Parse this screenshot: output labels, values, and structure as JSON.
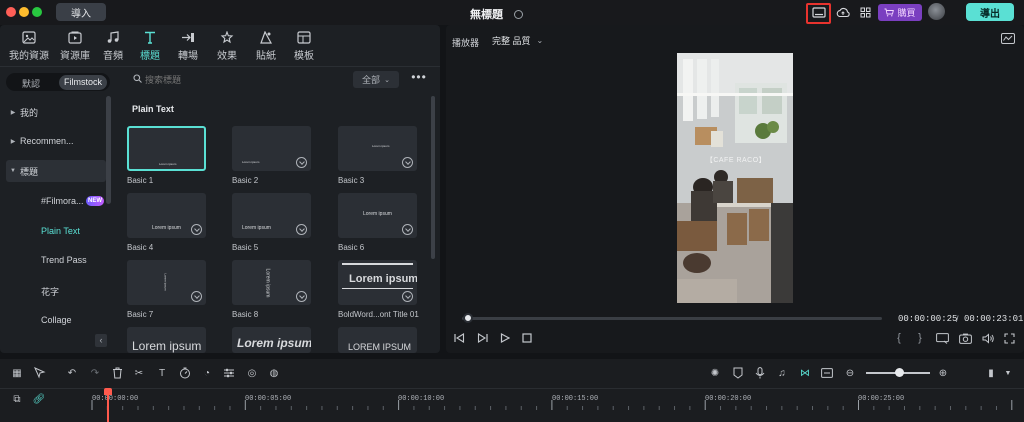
{
  "titlebar": {
    "import_label": "導入",
    "doc_title": "無標題",
    "buy_label": "購買",
    "export_label": "導出",
    "icons": [
      "monitor-icon",
      "cloud-upload-icon",
      "grid-icon",
      "cart-icon"
    ]
  },
  "tabs": [
    {
      "label": "我的資源",
      "icon": "media-icon"
    },
    {
      "label": "資源庫",
      "icon": "library-icon"
    },
    {
      "label": "音頻",
      "icon": "music-icon"
    },
    {
      "label": "標題",
      "icon": "text-icon",
      "active": true
    },
    {
      "label": "轉場",
      "icon": "transition-icon"
    },
    {
      "label": "效果",
      "icon": "effects-icon"
    },
    {
      "label": "貼紙",
      "icon": "sticker-icon"
    },
    {
      "label": "模板",
      "icon": "template-icon"
    }
  ],
  "source_toggle": {
    "default": "默認",
    "filmstock": "Filmstock"
  },
  "categories": {
    "mine": "我的",
    "recommended": "Recommen...",
    "titles": "標題",
    "sub": [
      "#Filmora...",
      "Plain Text",
      "Trend Pass",
      "花字",
      "Collage"
    ],
    "new_badge": "NEW"
  },
  "search": {
    "placeholder": "搜索標題"
  },
  "filter": {
    "label": "全部"
  },
  "section_title": "Plain Text",
  "thumbnails": [
    {
      "caption": "Basic 1",
      "text": "Lorem ipsum"
    },
    {
      "caption": "Basic 2",
      "text": "Lorem ipsum"
    },
    {
      "caption": "Basic 3",
      "text": "Lorem ipsum"
    },
    {
      "caption": "Basic 4",
      "text": "Lorem ipsum"
    },
    {
      "caption": "Basic 5",
      "text": "Lorem ipsum"
    },
    {
      "caption": "Basic 6",
      "text": "Lorem ipsum"
    },
    {
      "caption": "Basic 7",
      "text": "Lorem ipsum"
    },
    {
      "caption": "Basic 8",
      "text": "Lorem ipsum"
    },
    {
      "caption": "BoldWord...ont Title 01",
      "text": "Lorem ipsum"
    },
    {
      "caption": "",
      "text": "Lorem ipsum"
    },
    {
      "caption": "",
      "text": "Lorem ipsum"
    },
    {
      "caption": "",
      "text": "LOREM IPSUM"
    }
  ],
  "player": {
    "label": "播放器",
    "quality": "完整 品質",
    "video_caption": "【CAFE RACO】",
    "time_current": "00:00:00:25",
    "time_separator": "/",
    "time_total": "00:00:23:01",
    "progress": 0.01
  },
  "timeline": {
    "ticks": [
      "00:00:00:00",
      "00:00:05:00",
      "00:00:10:00",
      "00:00:15:00",
      "00:00:20:00",
      "00:00:25:00"
    ]
  },
  "colors": {
    "accent": "#5ae0d4",
    "buy": "#7a3fc0",
    "highlight": "#e8332e",
    "playhead": "#ff5a4d"
  }
}
